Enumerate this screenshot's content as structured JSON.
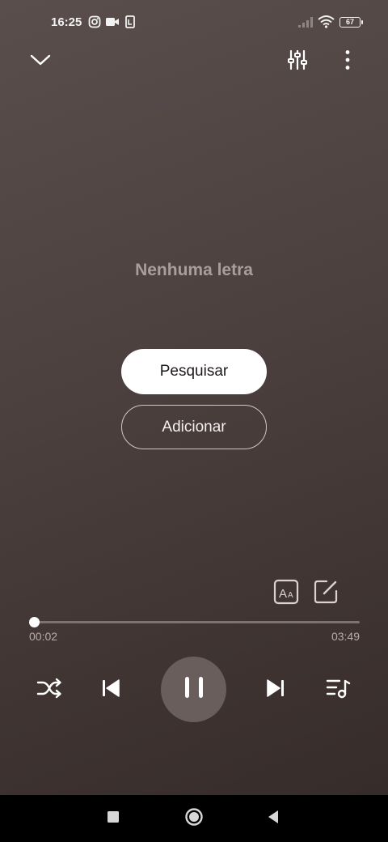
{
  "status_bar": {
    "time": "16:25",
    "battery": "67",
    "icons": [
      "instagram-icon",
      "video-camera-icon",
      "call-forward-icon",
      "signal-icon",
      "wifi-icon",
      "battery-icon"
    ]
  },
  "top_bar": {
    "icons": [
      "chevron-down-icon",
      "equalizer-icon",
      "more-vertical-icon"
    ]
  },
  "lyrics": {
    "empty_message": "Nenhuma letra",
    "search_label": "Pesquisar",
    "add_label": "Adicionar"
  },
  "tools": {
    "icons": [
      "font-size-icon",
      "edit-icon"
    ]
  },
  "player": {
    "current_time": "00:02",
    "total_time": "03:49",
    "progress_fraction": 0.009,
    "icons": [
      "shuffle-icon",
      "previous-icon",
      "pause-icon",
      "next-icon",
      "playlist-icon"
    ]
  },
  "nav_bar": {
    "icons": [
      "recent-apps-icon",
      "home-icon",
      "back-icon"
    ]
  },
  "colors": {
    "background_top": "#5a4e4d",
    "background_bottom": "#362c2a",
    "play_button": "#6a5e5c",
    "muted_text": "#a89f9d"
  }
}
